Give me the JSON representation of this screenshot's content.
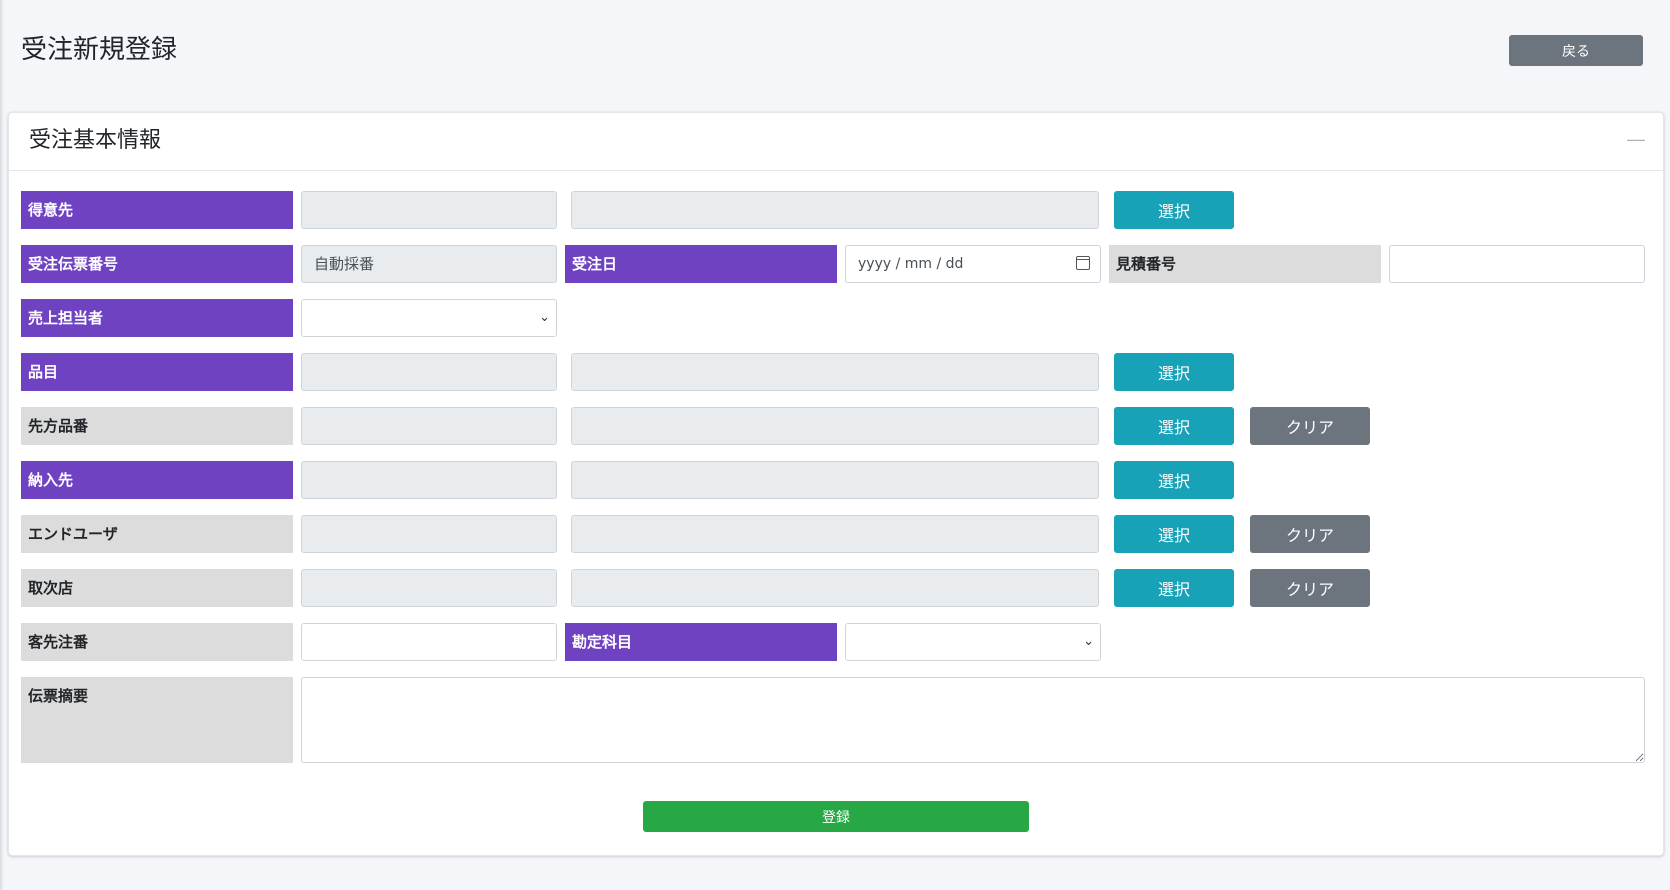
{
  "page": {
    "title": "受注新規登録",
    "back_label": "戻る"
  },
  "card": {
    "title": "受注基本情報",
    "collapse_icon": "minus-icon"
  },
  "labels": {
    "customer": "得意先",
    "order_slip_no": "受注伝票番号",
    "order_date": "受注日",
    "estimate_no": "見積番号",
    "sales_rep": "売上担当者",
    "item": "品目",
    "customer_part_no": "先方品番",
    "delivery_dest": "納入先",
    "end_user": "エンドユーザ",
    "agency": "取次店",
    "customer_order_no": "客先注番",
    "account": "勘定科目",
    "slip_summary": "伝票摘要"
  },
  "values": {
    "order_slip_no": "自動採番",
    "order_date_placeholder": "yyyy / mm / dd"
  },
  "buttons": {
    "select": "選択",
    "clear": "クリア",
    "submit": "登録"
  }
}
